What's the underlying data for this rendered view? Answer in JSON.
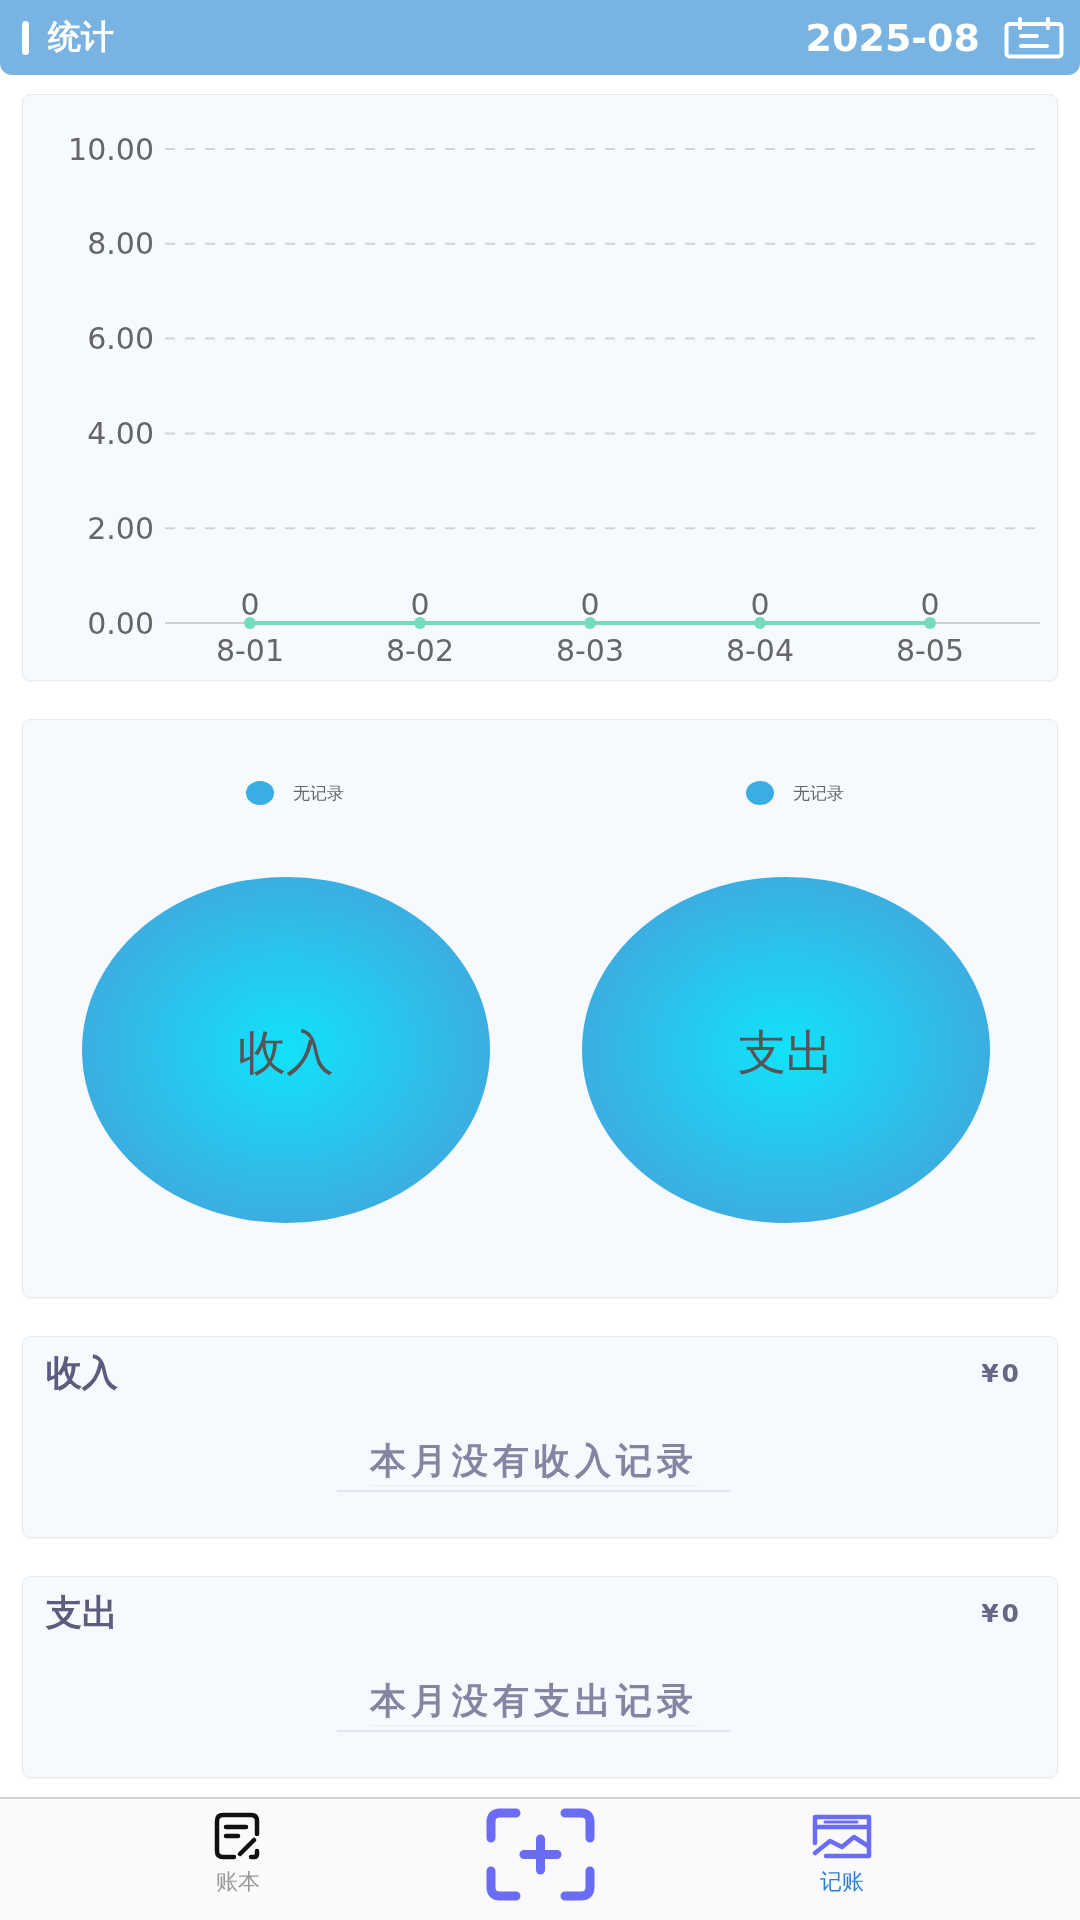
{
  "header": {
    "title": "统计",
    "month": "2025-08"
  },
  "trend_chart": {
    "chart_data": {
      "type": "line",
      "categories": [
        "8-01",
        "8-02",
        "8-03",
        "8-04",
        "8-05"
      ],
      "series": [
        {
          "color": "#72dcbd",
          "values": [
            0,
            0,
            0,
            0,
            0
          ],
          "marker": true
        }
      ],
      "ylim": [
        0,
        10
      ],
      "yticks": [
        {
          "value": 0,
          "label": "0.00"
        },
        {
          "value": 2,
          "label": "2.00"
        },
        {
          "value": 4,
          "label": "4.00"
        },
        {
          "value": 6,
          "label": "6.00"
        },
        {
          "value": 8,
          "label": "8.00"
        },
        {
          "value": 10,
          "label": "10.00"
        }
      ],
      "grid": true,
      "data_labels": true
    }
  },
  "pie_charts": [
    {
      "label": "收入",
      "legend": "无记录"
    },
    {
      "label": "支出",
      "legend": "无记录"
    }
  ],
  "sections": [
    {
      "title": "收入",
      "total": "¥0",
      "empty_text": "本月没有收入记录"
    },
    {
      "title": "支出",
      "total": "¥0",
      "empty_text": "本月没有支出记录"
    }
  ],
  "tab_bar": {
    "tabs": [
      {
        "label": "账本",
        "selected": false
      },
      {
        "label": "记账",
        "selected": true
      }
    ]
  }
}
